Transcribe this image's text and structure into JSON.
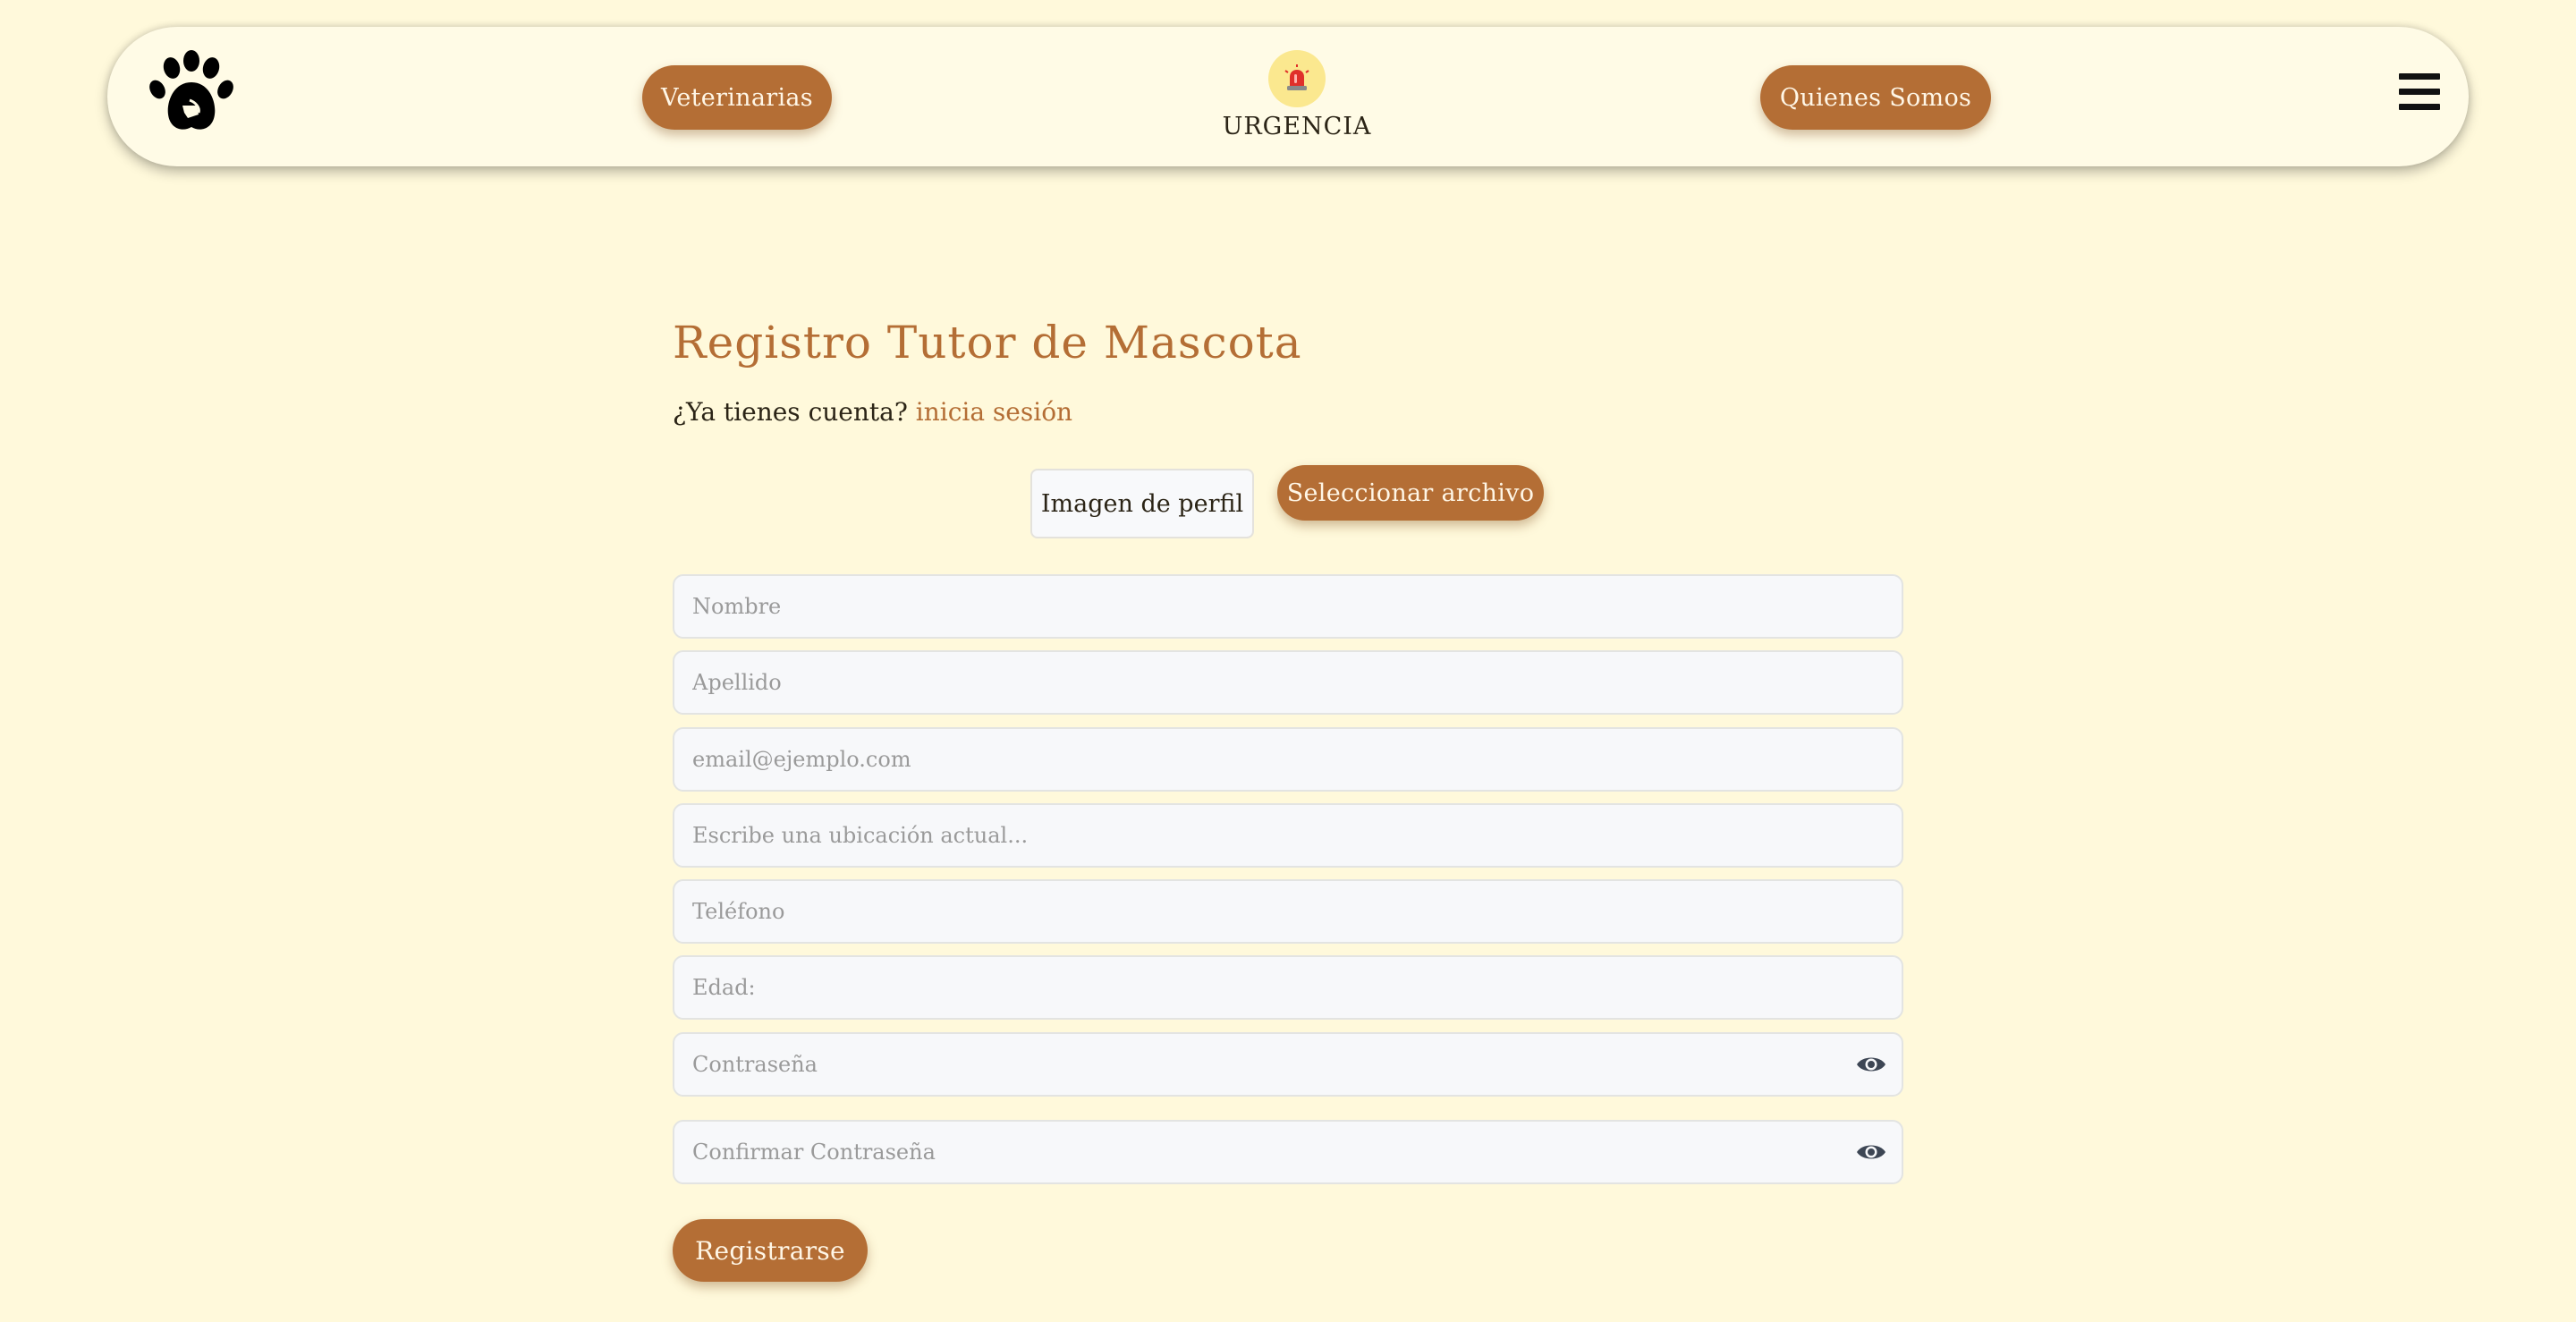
{
  "navbar": {
    "logo_icon": "paw-icon",
    "veterinarias_label": "Veterinarias",
    "urgencia_icon": "siren-icon",
    "urgencia_label": "URGENCIA",
    "quienes_label": "Quienes Somos",
    "menu_icon": "hamburger-menu-icon"
  },
  "form": {
    "title": "Registro Tutor de Mascota",
    "account_prompt": "¿Ya tienes cuenta?",
    "login_link": "inicia sesión",
    "profile_image_label": "Imagen de perfil",
    "file_button_label": "Seleccionar archivo",
    "fields": {
      "nombre": {
        "placeholder": "Nombre",
        "value": ""
      },
      "apellido": {
        "placeholder": "Apellido",
        "value": ""
      },
      "email": {
        "placeholder": "email@ejemplo.com",
        "value": ""
      },
      "ubicacion": {
        "placeholder": "Escribe una ubicación actual...",
        "value": ""
      },
      "telefono": {
        "placeholder": "Teléfono",
        "value": ""
      },
      "edad": {
        "placeholder": "Edad:",
        "value": ""
      },
      "password": {
        "placeholder": "Contraseña",
        "value": ""
      },
      "confirm_password": {
        "placeholder": "Confirmar Contraseña",
        "value": ""
      }
    },
    "toggle_icon": "eye-icon",
    "submit_label": "Registrarse"
  },
  "colors": {
    "background": "#fff9db",
    "accent": "#b46e35",
    "urgencia_circle": "#fbe88f"
  }
}
